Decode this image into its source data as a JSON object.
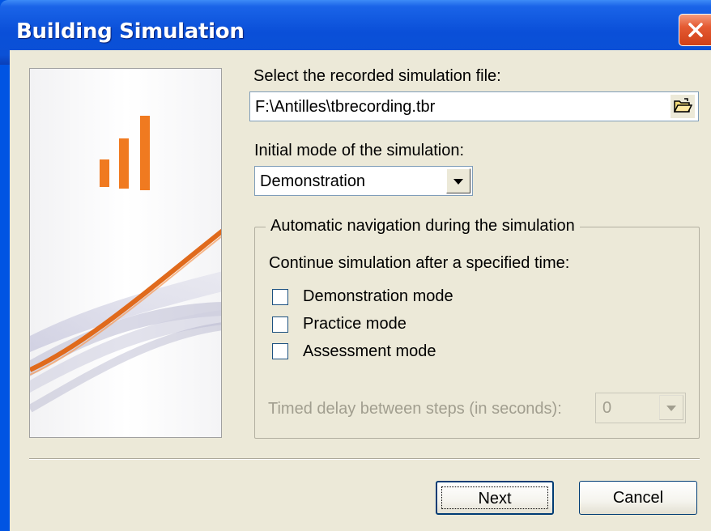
{
  "window": {
    "title": "Building Simulation"
  },
  "file": {
    "label": "Select the recorded simulation file:",
    "value": "F:\\Antilles\\tbrecording.tbr",
    "browse_icon": "folder-open-icon"
  },
  "mode": {
    "label": "Initial mode of the simulation:",
    "selected": "Demonstration"
  },
  "navigation": {
    "legend": "Automatic navigation during the simulation",
    "subtitle": "Continue simulation after a specified time:",
    "options": [
      {
        "label": "Demonstration mode",
        "checked": false
      },
      {
        "label": "Practice mode",
        "checked": false
      },
      {
        "label": "Assessment mode",
        "checked": false
      }
    ],
    "delay_label": "Timed delay between steps (in seconds):",
    "delay_value": "0"
  },
  "buttons": {
    "next": "Next",
    "cancel": "Cancel"
  },
  "colors": {
    "titlebar": "#0a4fd8",
    "accent_orange": "#f07a20",
    "dialog_bg": "#ece9d8"
  }
}
